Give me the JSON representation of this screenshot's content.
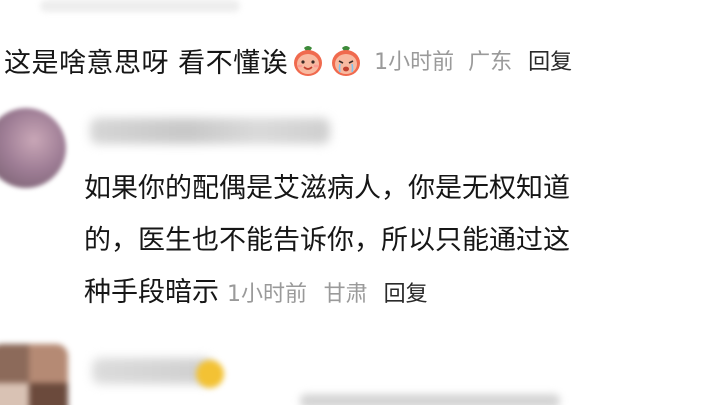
{
  "comments": [
    {
      "text": "这是啥意思呀 看不懂诶",
      "emoji": [
        "tomato-smile-emoji",
        "tomato-cry-emoji"
      ],
      "time": "1小时前",
      "location": "广东",
      "reply_label": "回复"
    },
    {
      "lines": [
        "如果你的配偶是艾滋病人，你是无权知道",
        "的，医生也不能告诉你，所以只能通过这",
        "种手段暗示"
      ],
      "time": "1小时前",
      "location": "甘肃",
      "reply_label": "回复"
    }
  ],
  "colors": {
    "text": "#161616",
    "meta": "#9a9a9a",
    "background": "#ffffff"
  }
}
